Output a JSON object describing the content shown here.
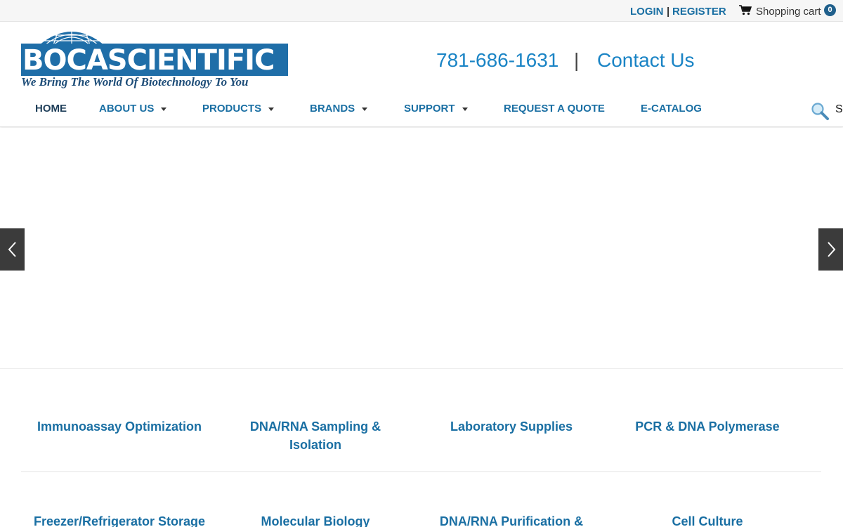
{
  "topbar": {
    "login": "LOGIN",
    "separator": "|",
    "register": "REGISTER",
    "cart_label": "Shopping cart",
    "cart_count": "0",
    "cart_icon": "shopping-cart-icon"
  },
  "logo": {
    "wordmark": "BOCASCIENTIFIC",
    "tagline": "We Bring The World Of Biotechnology To You",
    "globe_icon": "globe-grid-icon"
  },
  "header": {
    "phone": "781-686-1631",
    "separator": "|",
    "contact": "Contact Us"
  },
  "nav": {
    "items": [
      {
        "label": "HOME",
        "dropdown": false
      },
      {
        "label": "ABOUT US",
        "dropdown": true
      },
      {
        "label": "PRODUCTS",
        "dropdown": true
      },
      {
        "label": "BRANDS",
        "dropdown": true
      },
      {
        "label": "SUPPORT",
        "dropdown": true
      },
      {
        "label": "REQUEST A QUOTE",
        "dropdown": false
      },
      {
        "label": "E-CATALOG",
        "dropdown": false
      }
    ],
    "search_icon": "magnifier-icon",
    "search_label": "S"
  },
  "slider": {
    "prev_icon": "chevron-left-icon",
    "next_icon": "chevron-right-icon"
  },
  "categories": [
    "Immunoassay Optimization",
    "DNA/RNA Sampling & Isolation",
    "Laboratory Supplies",
    "PCR & DNA Polymerase",
    "Freezer/Refrigerator Storage",
    "Molecular Biology",
    "DNA/RNA Purification &",
    "Cell Culture"
  ],
  "colors": {
    "link_blue": "#1a6fa3",
    "phone_blue": "#1a84c5",
    "logo_blue": "#1f6ea8",
    "badge": "#1f5f8b"
  }
}
